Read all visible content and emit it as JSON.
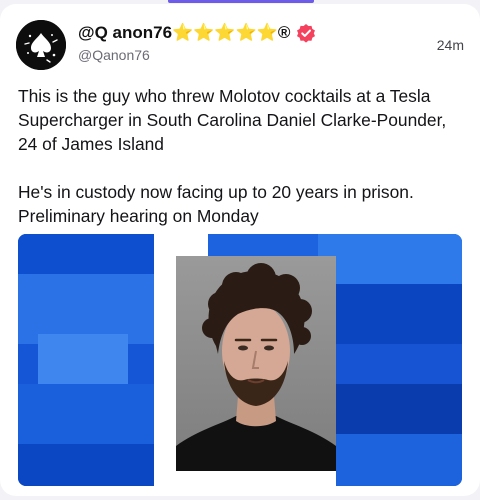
{
  "post": {
    "display_name": "@Q anon76⭐⭐⭐⭐⭐®",
    "handle": "@Qanon76",
    "timestamp": "24m",
    "paragraphs": [
      "This is the guy who threw Molotov cocktails at a Tesla Supercharger in South Carolina Daniel Clarke-Pounder, 24 of James Island",
      "He's in custody now facing up to 20 years in prison. Preliminary hearing on Monday"
    ],
    "badge_icon": "verified-badge-icon",
    "badge_color": "#f4425e"
  },
  "colors": {
    "accent": "#6c5ce7",
    "media_blue": "#1456d6"
  }
}
